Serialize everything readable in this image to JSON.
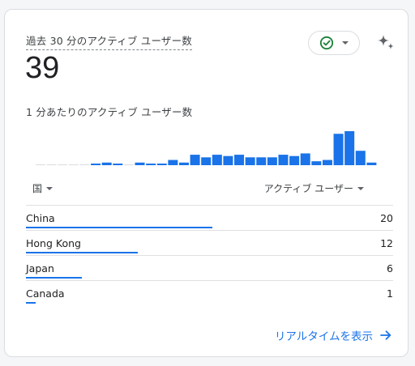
{
  "card": {
    "metric_label": "過去 30 分のアクティブ ユーザー数",
    "metric_value": "39",
    "per_minute_label": "1 分あたりのアクティブ ユーザー数",
    "view_realtime_label": "リアルタイムを表示",
    "accent_color": "#1a73e8",
    "status_color": "#188038"
  },
  "table": {
    "dimension_header": "国",
    "metric_header": "アクティブ ユーザー",
    "rows": [
      {
        "country": "China",
        "users": "20",
        "share": 1.0
      },
      {
        "country": "Hong Kong",
        "users": "12",
        "share": 0.6
      },
      {
        "country": "Japan",
        "users": "6",
        "share": 0.3
      },
      {
        "country": "Canada",
        "users": "1",
        "share": 0.05
      }
    ]
  },
  "chart_data": {
    "type": "bar",
    "title": "1 分あたりのアクティブ ユーザー数",
    "values": [
      0,
      0,
      0,
      0,
      0,
      1,
      2,
      1,
      0,
      2,
      1,
      1,
      4,
      2,
      8,
      6,
      8,
      7,
      8,
      6,
      6,
      6,
      8,
      7,
      9,
      3,
      4,
      24,
      26,
      11,
      2
    ],
    "ylim": [
      0,
      26
    ]
  }
}
